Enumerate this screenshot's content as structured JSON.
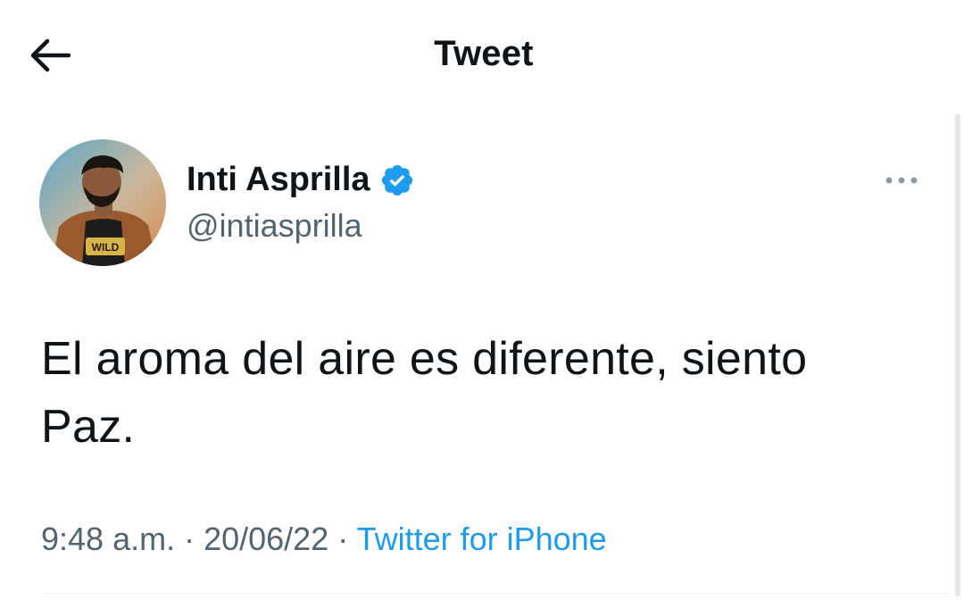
{
  "header": {
    "title": "Tweet",
    "back_icon": "arrow-left-icon"
  },
  "author": {
    "name": "Inti Asprilla",
    "handle": "@intiasprilla",
    "verified": true,
    "verified_icon": "verified-badge-icon",
    "avatar_icon": "profile-photo",
    "avatar_shirt_text": "WILD"
  },
  "more_icon": "more-options-icon",
  "tweet": {
    "text_line1": "El aroma del aire es diferente, siento",
    "text_line2": "Paz."
  },
  "meta": {
    "time": "9:48 a.m.",
    "sep1": " · ",
    "date": "20/06/22",
    "sep2": " · ",
    "source": "Twitter for iPhone"
  },
  "colors": {
    "accent": "#1d9bf0",
    "text": "#0f1419",
    "secondary": "#536471"
  }
}
